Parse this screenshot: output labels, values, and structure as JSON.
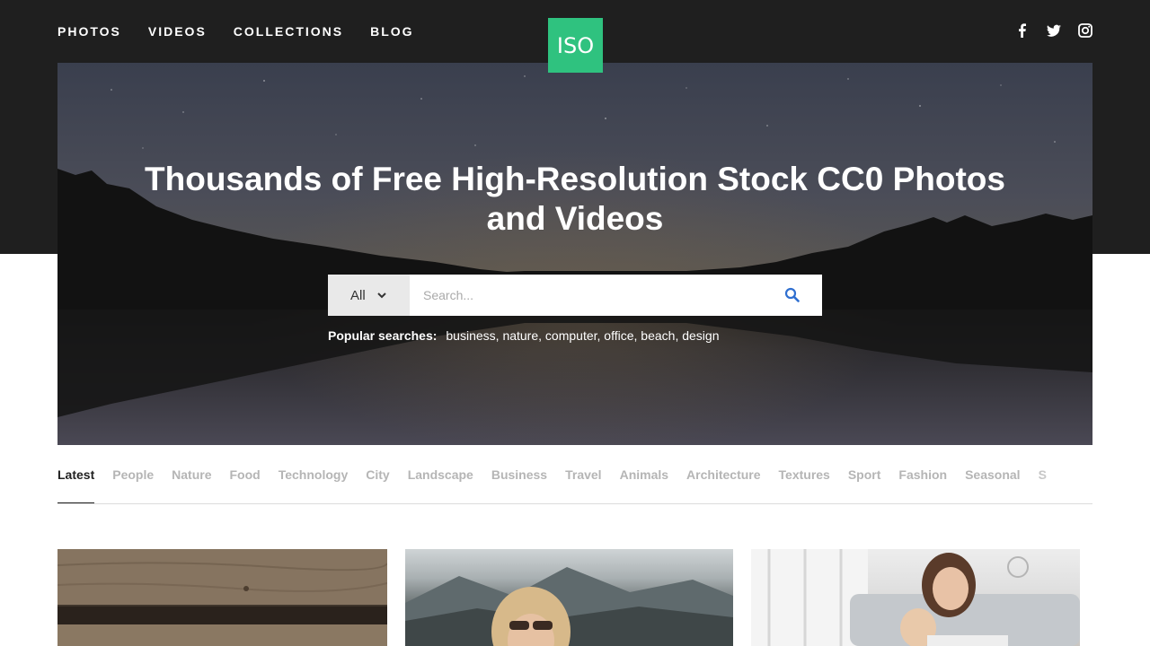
{
  "nav": {
    "items": [
      {
        "label": "PHOTOS"
      },
      {
        "label": "VIDEOS"
      },
      {
        "label": "COLLECTIONS"
      },
      {
        "label": "BLOG"
      }
    ]
  },
  "logo": {
    "text": "ISO",
    "color": "#2fc27f"
  },
  "social": {
    "icons": [
      "facebook-icon",
      "twitter-icon",
      "instagram-icon"
    ]
  },
  "hero": {
    "title": "Thousands of Free High-Resolution Stock CC0 Photos and Videos",
    "search": {
      "type_value": "All",
      "placeholder": "Search..."
    },
    "popular": {
      "label": "Popular searches:",
      "terms": [
        "business,",
        "nature,",
        "computer,",
        "office,",
        "beach,",
        "design"
      ]
    }
  },
  "categories": {
    "active": "Latest",
    "items": [
      "Latest",
      "People",
      "Nature",
      "Food",
      "Technology",
      "City",
      "Landscape",
      "Business",
      "Travel",
      "Animals",
      "Architecture",
      "Textures",
      "Sport",
      "Fashion",
      "Seasonal",
      "S"
    ]
  },
  "colors": {
    "header_bg": "#1f1f1f",
    "accent": "#2fc27f",
    "search_icon": "#2f6fd0"
  }
}
